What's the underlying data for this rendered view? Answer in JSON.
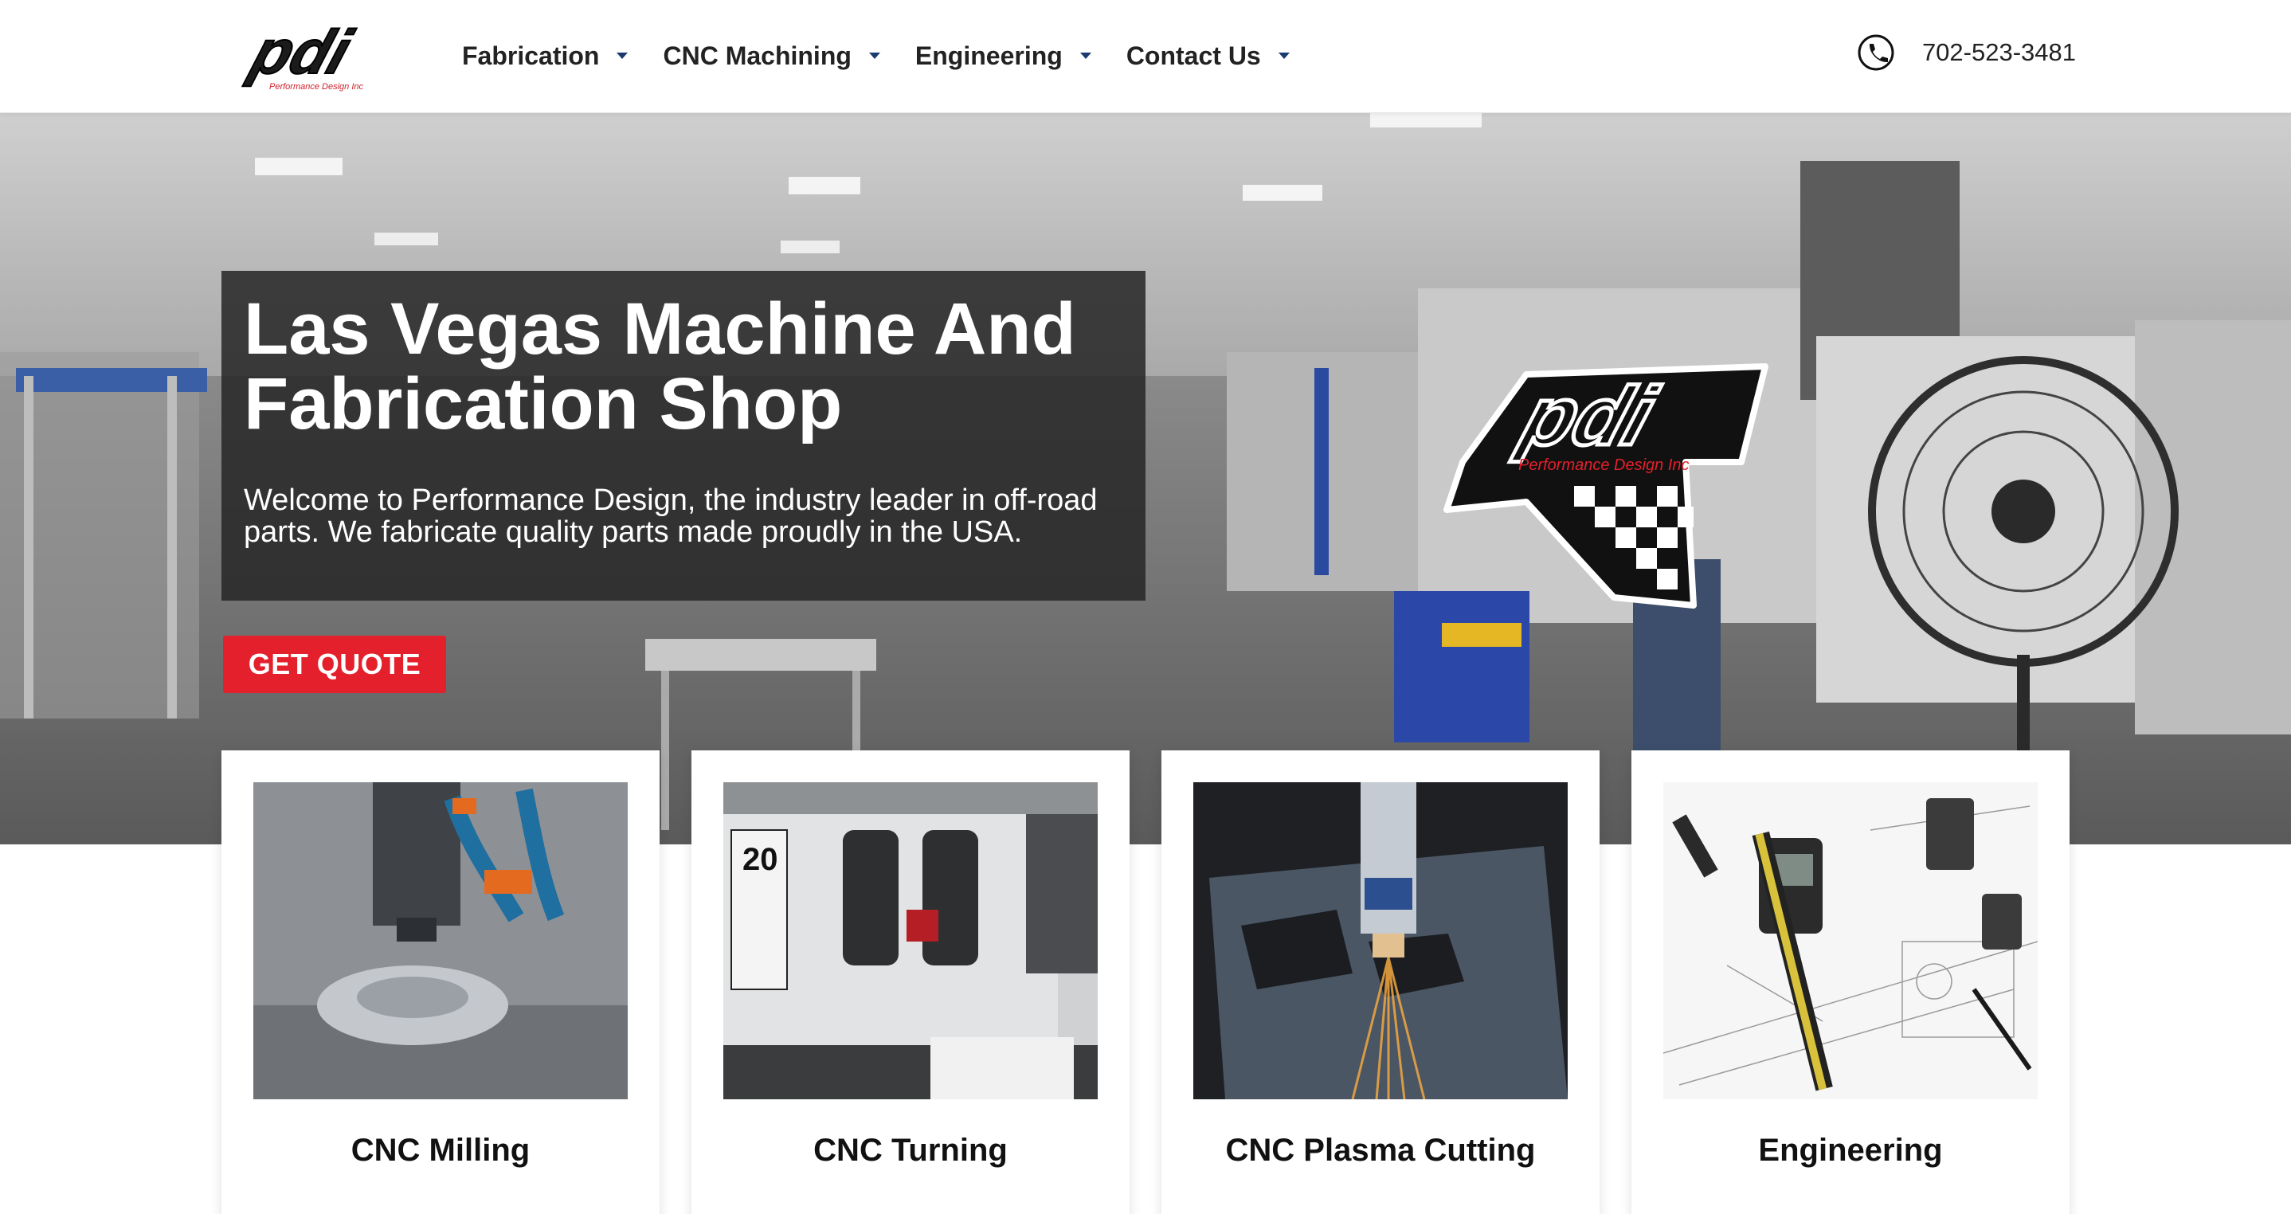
{
  "header": {
    "logo_text": "pdi",
    "logo_subtext": "Performance Design Inc",
    "nav": [
      {
        "label": "Fabrication"
      },
      {
        "label": "CNC Machining"
      },
      {
        "label": "Engineering"
      },
      {
        "label": "Contact Us"
      }
    ],
    "phone": "702-523-3481",
    "phone_icon": "phone-icon"
  },
  "hero": {
    "title": "Las Vegas Machine And Fabrication Shop",
    "text": "Welcome to Performance Design, the industry leader in off-road parts. We fabricate quality parts made proudly in the USA.",
    "cta_label": "GET QUOTE",
    "badge_text": "pdi",
    "badge_subtext": "Performance Design Inc"
  },
  "services": [
    {
      "title": "CNC Milling"
    },
    {
      "title": "CNC Turning"
    },
    {
      "title": "CNC Plasma Cutting"
    },
    {
      "title": "Engineering"
    }
  ],
  "colors": {
    "accent_red": "#e3202c",
    "nav_caret": "#1b3b6f",
    "panel": "#262626"
  }
}
